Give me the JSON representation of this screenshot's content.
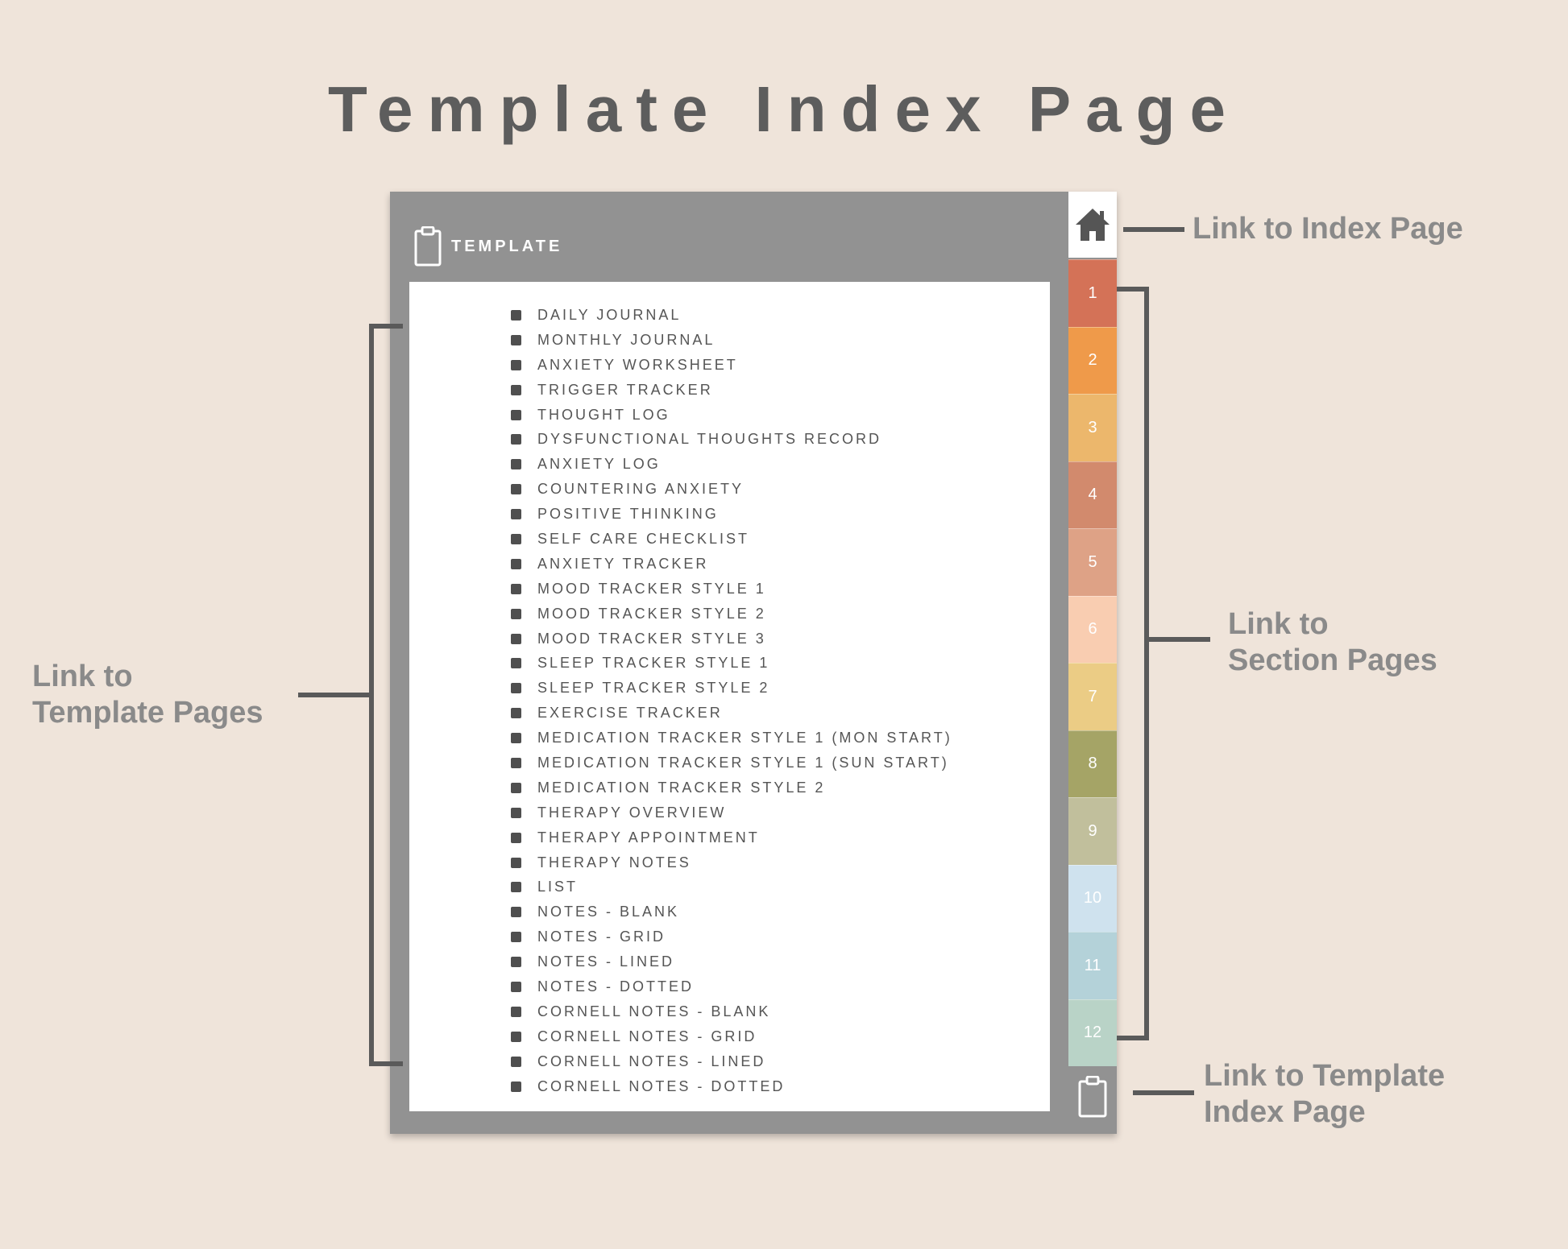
{
  "title": "Template Index Page",
  "planner": {
    "header_label": "TEMPLATE",
    "header_icon": "clipboard-icon",
    "templates": [
      "DAILY JOURNAL",
      "MONTHLY JOURNAL",
      "ANXIETY WORKSHEET",
      "TRIGGER TRACKER",
      "THOUGHT LOG",
      "DYSFUNCTIONAL THOUGHTS RECORD",
      "ANXIETY LOG",
      "COUNTERING ANXIETY",
      "POSITIVE THINKING",
      "SELF CARE CHECKLIST",
      "ANXIETY TRACKER",
      "MOOD TRACKER STYLE 1",
      "MOOD TRACKER STYLE 2",
      "MOOD TRACKER STYLE 3",
      "SLEEP TRACKER STYLE 1",
      "SLEEP TRACKER STYLE 2",
      "EXERCISE TRACKER",
      "MEDICATION TRACKER STYLE 1 (MON START)",
      "MEDICATION TRACKER STYLE 1 (SUN START)",
      "MEDICATION TRACKER STYLE 2",
      "THERAPY OVERVIEW",
      "THERAPY APPOINTMENT",
      "THERAPY NOTES",
      "LIST",
      "NOTES - BLANK",
      "NOTES - GRID",
      "NOTES - LINED",
      "NOTES - DOTTED",
      "CORNELL NOTES - BLANK",
      "CORNELL NOTES - GRID",
      "CORNELL NOTES - LINED",
      "CORNELL NOTES - DOTTED"
    ],
    "home_tab_icon": "home-icon",
    "section_tabs": [
      {
        "label": "1",
        "color": "#d47257"
      },
      {
        "label": "2",
        "color": "#ef9a4a"
      },
      {
        "label": "3",
        "color": "#ecb76c"
      },
      {
        "label": "4",
        "color": "#d28a6d"
      },
      {
        "label": "5",
        "color": "#dea286"
      },
      {
        "label": "6",
        "color": "#f9cdb1"
      },
      {
        "label": "7",
        "color": "#ebcc85"
      },
      {
        "label": "8",
        "color": "#a5a466"
      },
      {
        "label": "9",
        "color": "#c1bf9c"
      },
      {
        "label": "10",
        "color": "#cfe2ee"
      },
      {
        "label": "11",
        "color": "#b4d2d9"
      },
      {
        "label": "12",
        "color": "#b9d3c7"
      }
    ],
    "bottom_tab_icon": "clipboard-icon"
  },
  "annotations": {
    "index_page": "Link to Index Page",
    "section_pages_line1": "Link to",
    "section_pages_line2": "Section Pages",
    "template_pages_line1": "Link to",
    "template_pages_line2": "Template Pages",
    "template_index_line1": "Link to Template",
    "template_index_line2": "Index Page"
  }
}
